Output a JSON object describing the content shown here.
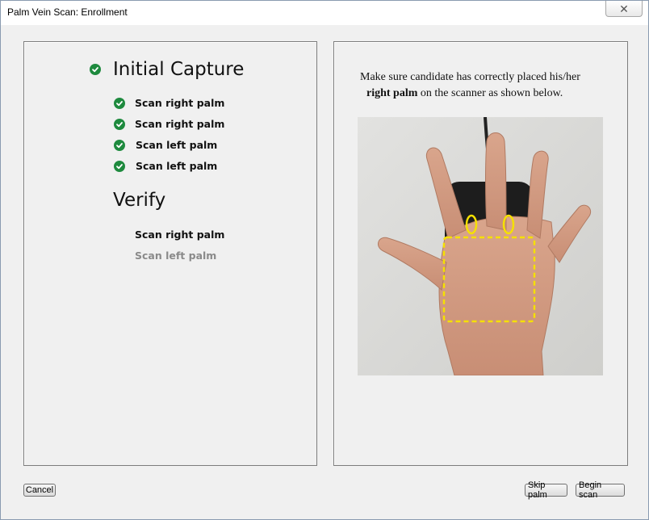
{
  "window": {
    "title": "Palm Vein Scan: Enrollment",
    "close_glyph": "✕"
  },
  "steps": {
    "initial_capture": {
      "title": "Initial Capture",
      "items": [
        {
          "label": "Scan right palm",
          "status": "complete"
        },
        {
          "label": "Scan right palm",
          "status": "complete"
        },
        {
          "label": "Scan left palm",
          "status": "complete"
        },
        {
          "label": "Scan left palm",
          "status": "complete"
        }
      ]
    },
    "verify": {
      "title": "Verify",
      "items": [
        {
          "label": "Scan right palm",
          "status": "active"
        },
        {
          "label": "Scan left palm",
          "status": "pending"
        }
      ]
    }
  },
  "instruction": {
    "line1": "Make sure candidate has correctly placed his/her",
    "emphasis": "right palm",
    "line2_rest": " on the scanner as shown below."
  },
  "buttons": {
    "cancel": "Cancel",
    "skip": "Skip palm",
    "begin": "Begin scan"
  },
  "colors": {
    "check_green": "#1e8a3e",
    "guide_yellow": "#f5e000"
  },
  "icons": {
    "check": "check-circle-icon",
    "close": "close-icon"
  }
}
